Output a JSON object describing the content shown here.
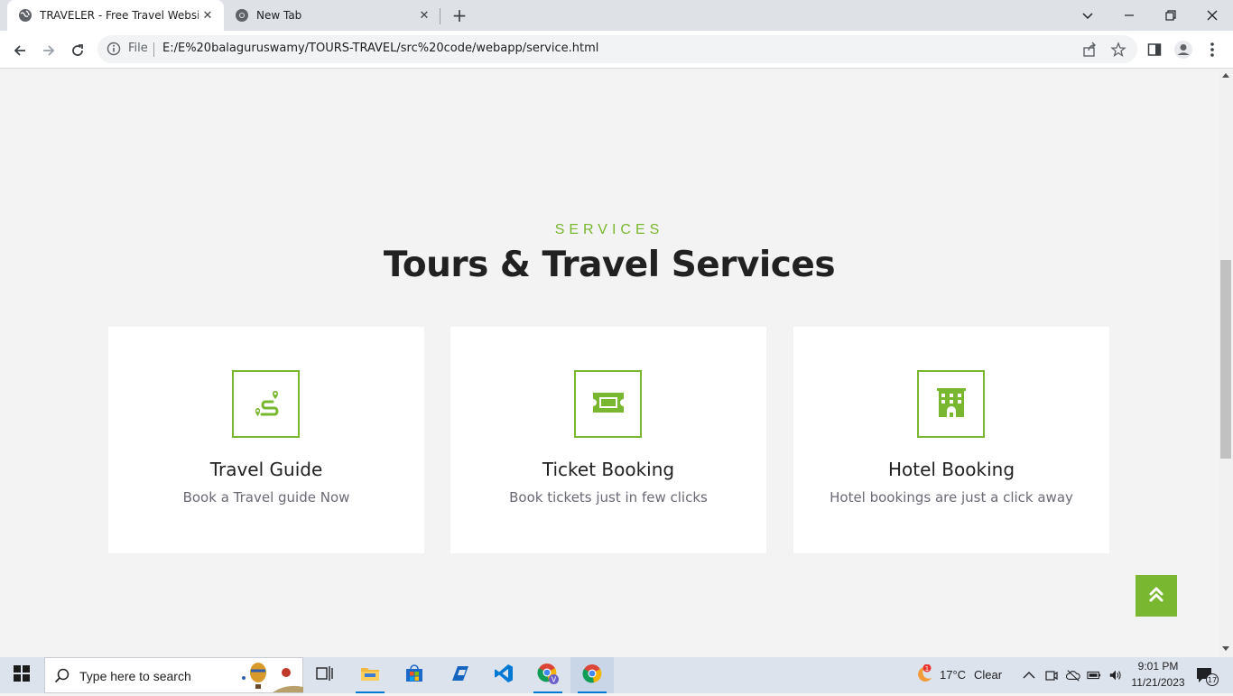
{
  "browser": {
    "tabs": [
      {
        "title": "TRAVELER - Free Travel Website",
        "active": true
      },
      {
        "title": "New Tab",
        "active": false
      }
    ],
    "address": {
      "scheme_label": "File",
      "url": "E:/E%20balaguruswamy/TOURS-TRAVEL/src%20code/webapp/service.html"
    }
  },
  "page": {
    "section_label": "SERVICES",
    "section_title": "Tours & Travel Services",
    "cards": [
      {
        "title": "Travel Guide",
        "description": "Book a Travel guide Now",
        "icon": "route-icon"
      },
      {
        "title": "Ticket Booking",
        "description": "Book tickets just in few clicks",
        "icon": "ticket-icon"
      },
      {
        "title": "Hotel Booking",
        "description": "Hotel bookings are just a click away",
        "icon": "hotel-icon"
      }
    ],
    "accent_color": "#7ab730"
  },
  "taskbar": {
    "search_placeholder": "Type here to search",
    "weather": {
      "temp": "17°C",
      "condition": "Clear",
      "badge": "1"
    },
    "clock": {
      "time": "9:01 PM",
      "date": "11/21/2023"
    },
    "notifications": "17"
  }
}
